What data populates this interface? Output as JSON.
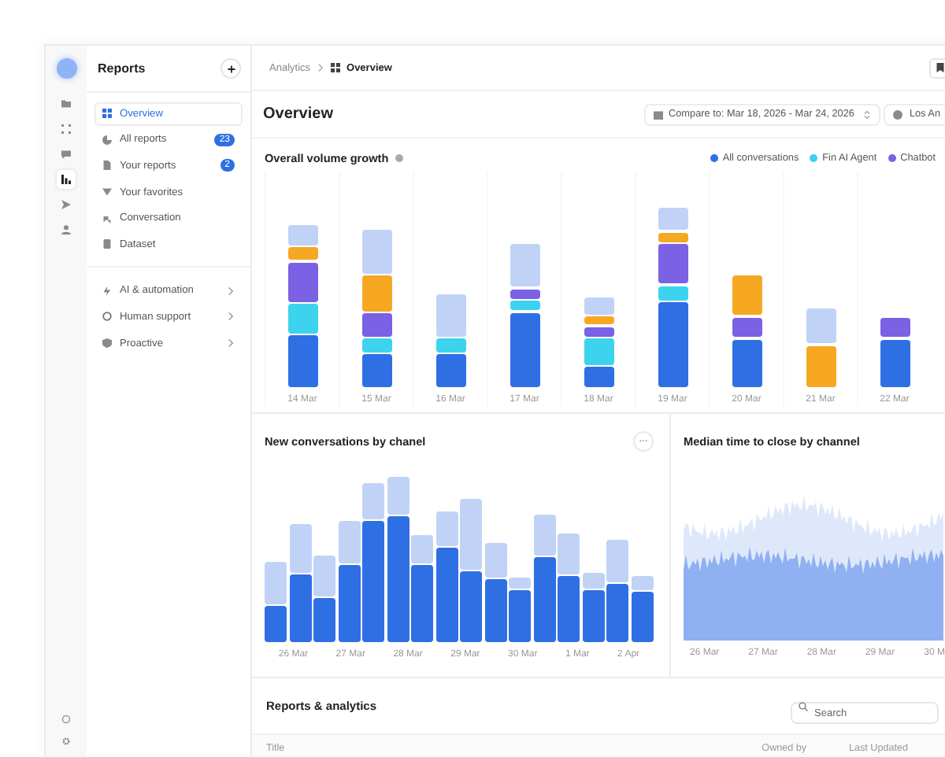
{
  "rail": [
    {
      "selected": false
    },
    {
      "selected": false
    },
    {
      "selected": false
    },
    {
      "selected": true
    },
    {
      "selected": false
    },
    {
      "selected": false
    }
  ],
  "sidebar": {
    "title": "Reports",
    "items": [
      {
        "label": "Overview",
        "selected": true
      },
      {
        "label": "All reports",
        "badge": "23",
        "selected": false
      },
      {
        "label": "Your reports",
        "badge": "2",
        "selected": false
      },
      {
        "label": "Your favorites",
        "selected": false
      },
      {
        "label": "Conversation",
        "selected": false
      },
      {
        "label": "Dataset",
        "selected": false
      }
    ],
    "groups": [
      {
        "label": "AI & automation"
      },
      {
        "label": "Human support"
      },
      {
        "label": "Proactive"
      }
    ]
  },
  "breadcrumb": [
    "Analytics",
    "Overview"
  ],
  "page_title": "Overview",
  "compare": "Compare to: Mar 18, 2026 - Mar 24, 2026",
  "timezone": "Los An",
  "volume_chart": {
    "title": "Overall volume growth",
    "legend": [
      {
        "label": "All conversations",
        "color": "#2f6fe4"
      },
      {
        "label": "Fin AI Agent",
        "color": "#3dd3ee"
      },
      {
        "label": "Chatbot",
        "color": "#7b61e4"
      }
    ],
    "x_labels": [
      "14 Mar",
      "15 Mar",
      "16 Mar",
      "17 Mar",
      "18 Mar",
      "19 Mar",
      "20 Mar",
      "21 Mar",
      "22 Mar"
    ]
  },
  "conversations_chart": {
    "title": "New conversations by chanel",
    "x_labels": [
      "26 Mar",
      "27 Mar",
      "28 Mar",
      "29 Mar",
      "30 Mar",
      "1 Mar",
      "2 Apr"
    ]
  },
  "close_time_chart": {
    "title": "Median time to close by channel",
    "x_labels": [
      "26 Mar",
      "27 Mar",
      "28 Mar",
      "29 Mar",
      "30 M"
    ]
  },
  "reports": {
    "title": "Reports & analytics",
    "search": {
      "placeholder": "Search"
    },
    "columns": [
      "Title",
      "Owned by",
      "Last Updated"
    ]
  }
}
